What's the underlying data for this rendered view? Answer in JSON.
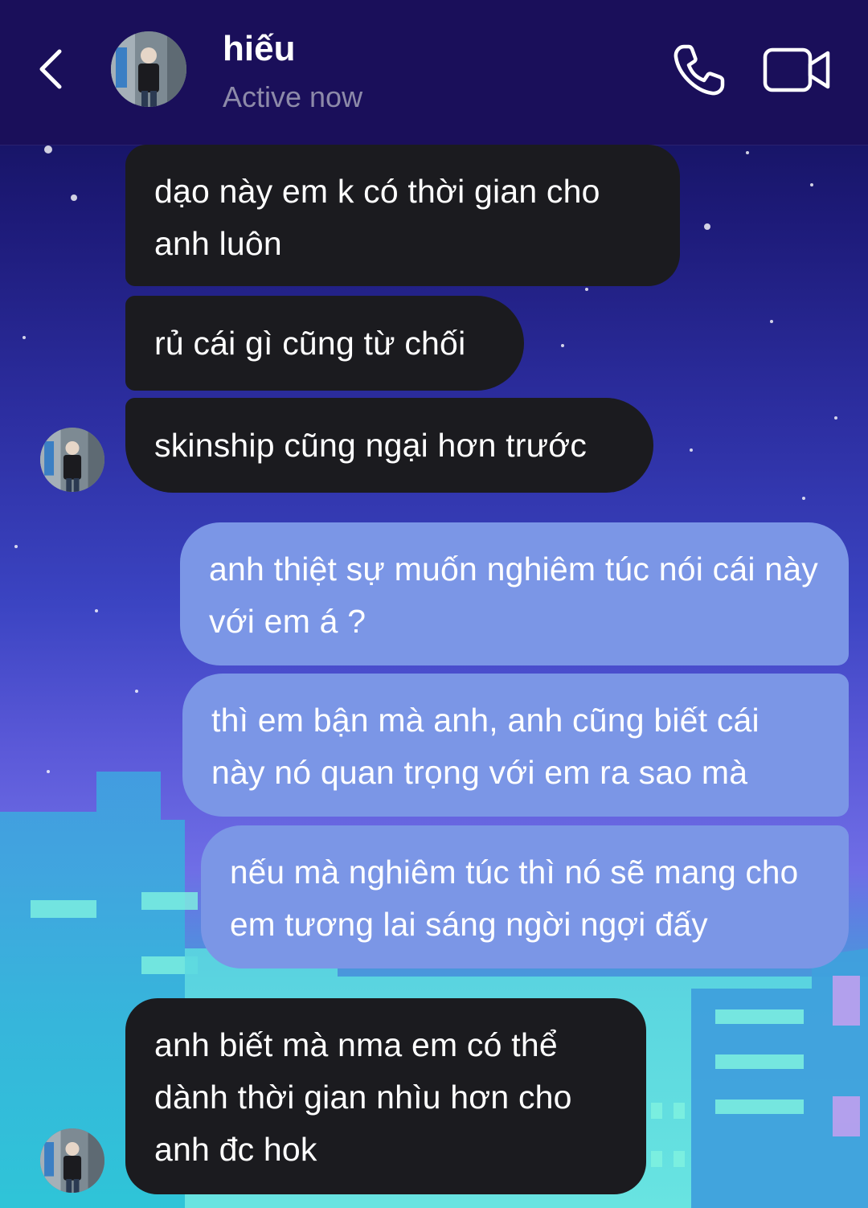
{
  "header": {
    "contact_name": "hiếu",
    "status": "Active now",
    "icons": [
      "chevron-left-icon",
      "phone-icon",
      "video-camera-icon"
    ]
  },
  "messages": [
    {
      "from": "contact",
      "text": "dạo này em k có thời gian cho anh luôn"
    },
    {
      "from": "contact",
      "text": "rủ cái gì cũng từ chối"
    },
    {
      "from": "contact",
      "text": "skinship cũng ngại hơn trước"
    },
    {
      "from": "me",
      "text": "anh thiệt sự muốn nghiêm túc nói cái này với em á ?"
    },
    {
      "from": "me",
      "text": "thì em bận mà anh, anh cũng biết cái này nó quan trọng với em ra sao mà"
    },
    {
      "from": "me",
      "text": "nếu mà nghiêm túc thì nó sẽ mang cho em tương lai sáng ngời ngợi đấy"
    },
    {
      "from": "contact",
      "text": "anh biết mà nma em có thể dành thời gian nhìu hơn cho anh đc hok"
    }
  ],
  "colors": {
    "header_bg": "#1a0f5a",
    "incoming_bubble": "#1b1b1f",
    "outgoing_bubble": "#7b96e6",
    "status_text": "#8d8aa9"
  }
}
